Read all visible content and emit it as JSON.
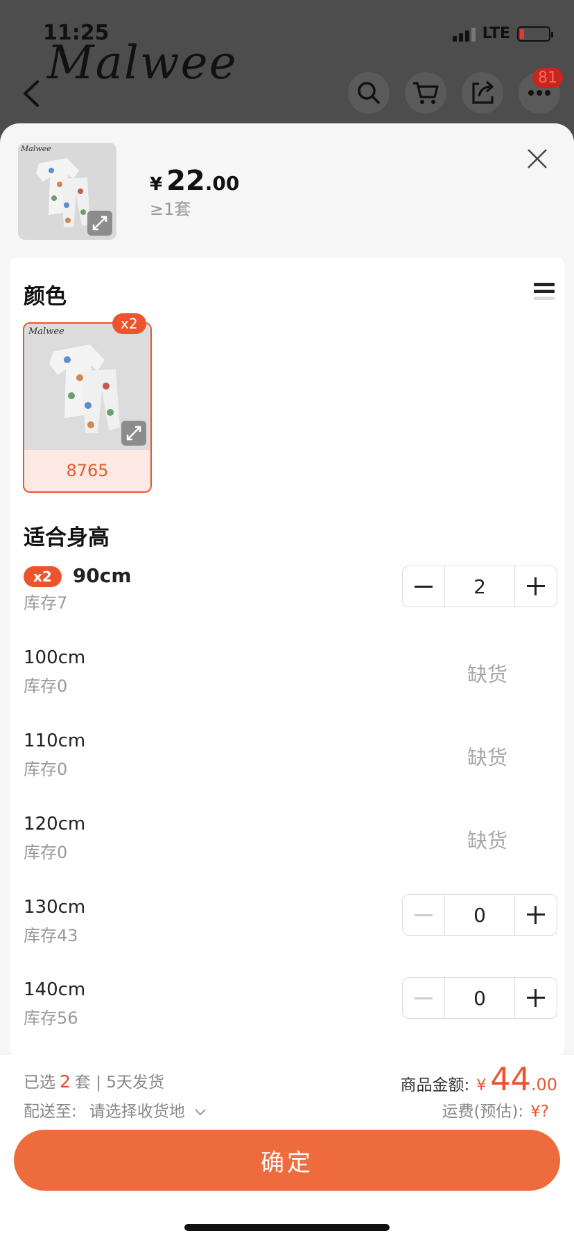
{
  "status": {
    "time": "11:25",
    "network": "LTE"
  },
  "header": {
    "logo": "Malwee",
    "message_count": "81"
  },
  "product": {
    "currency": "¥",
    "price_int": "22",
    "price_dec": ".00",
    "moq": "≥1套"
  },
  "color_section": {
    "title": "颜色",
    "items": [
      {
        "label": "8765",
        "qty_badge": "x2"
      }
    ]
  },
  "size_section": {
    "title": "适合身高",
    "rows": [
      {
        "size": "90cm",
        "stock": "库存7",
        "badge": "x2",
        "qty": "2",
        "status": ""
      },
      {
        "size": "100cm",
        "stock": "库存0",
        "status": "缺货"
      },
      {
        "size": "110cm",
        "stock": "库存0",
        "status": "缺货"
      },
      {
        "size": "120cm",
        "stock": "库存0",
        "status": "缺货"
      },
      {
        "size": "130cm",
        "stock": "库存43",
        "qty": "0"
      },
      {
        "size": "140cm",
        "stock": "库存56",
        "qty": "0"
      }
    ]
  },
  "footer": {
    "selected_prefix": "已选",
    "selected_count": "2",
    "selected_suffix": "套 | 5天发货",
    "ship_to_label": "配送至:",
    "ship_to_value": "请选择收货地",
    "amount_label": "商品金额:",
    "amount_currency": "¥",
    "amount_int": "44",
    "amount_dec": ".00",
    "freight_label": "运费(预估):",
    "freight_value": "¥?",
    "confirm_label": "确定"
  },
  "colors": {
    "accent": "#ee6b3d",
    "badge": "#ec542e"
  }
}
